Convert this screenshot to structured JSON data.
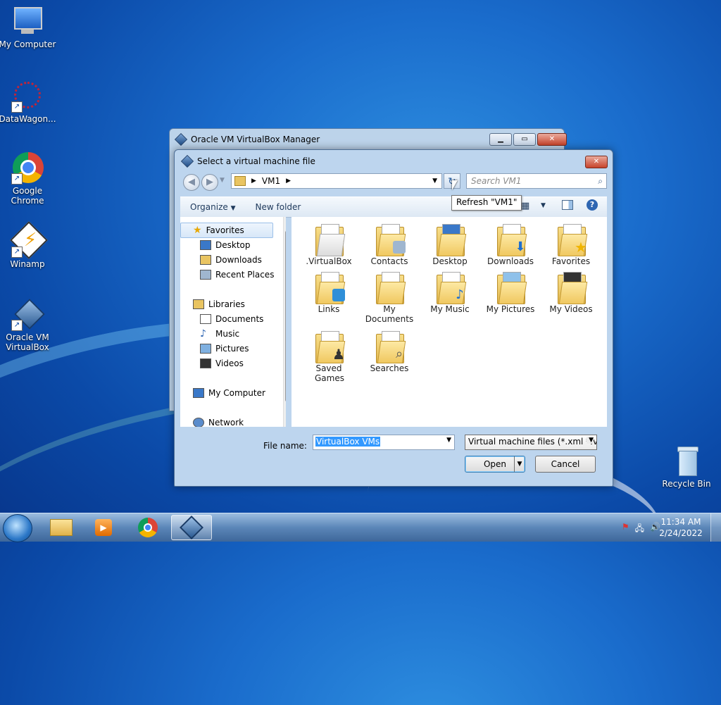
{
  "desktop": {
    "icons": [
      {
        "label": "My Computer"
      },
      {
        "label": "DataWagon..."
      },
      {
        "label": "Google Chrome"
      },
      {
        "label": "Winamp"
      },
      {
        "label": "Oracle VM VirtualBox"
      },
      {
        "label": "Recycle Bin"
      }
    ]
  },
  "bg_window": {
    "title": "Oracle VM VirtualBox Manager"
  },
  "dialog": {
    "title": "Select a virtual machine file",
    "path": [
      "VM1"
    ],
    "search_placeholder": "Search VM1",
    "tooltip": "Refresh \"VM1\"",
    "toolbar": {
      "organize": "Organize",
      "new_folder": "New folder"
    },
    "nav": {
      "favorites": "Favorites",
      "desktop": "Desktop",
      "downloads": "Downloads",
      "recent": "Recent Places",
      "libraries": "Libraries",
      "documents": "Documents",
      "music": "Music",
      "pictures": "Pictures",
      "videos": "Videos",
      "computer": "My Computer",
      "network": "Network"
    },
    "folders": [
      {
        "name": ".VirtualBox"
      },
      {
        "name": "Contacts"
      },
      {
        "name": "Desktop"
      },
      {
        "name": "Downloads"
      },
      {
        "name": "Favorites"
      },
      {
        "name": "Links"
      },
      {
        "name": "My Documents"
      },
      {
        "name": "My Music"
      },
      {
        "name": "My Pictures"
      },
      {
        "name": "My Videos"
      },
      {
        "name": "Saved Games"
      },
      {
        "name": "Searches"
      }
    ],
    "filename_label": "File name:",
    "filename_value": "VirtualBox VMs",
    "filetype": "Virtual machine files (*.xml *.vb",
    "open": "Open",
    "cancel": "Cancel"
  },
  "taskbar": {
    "time": "11:34 AM",
    "date": "2/24/2022"
  }
}
